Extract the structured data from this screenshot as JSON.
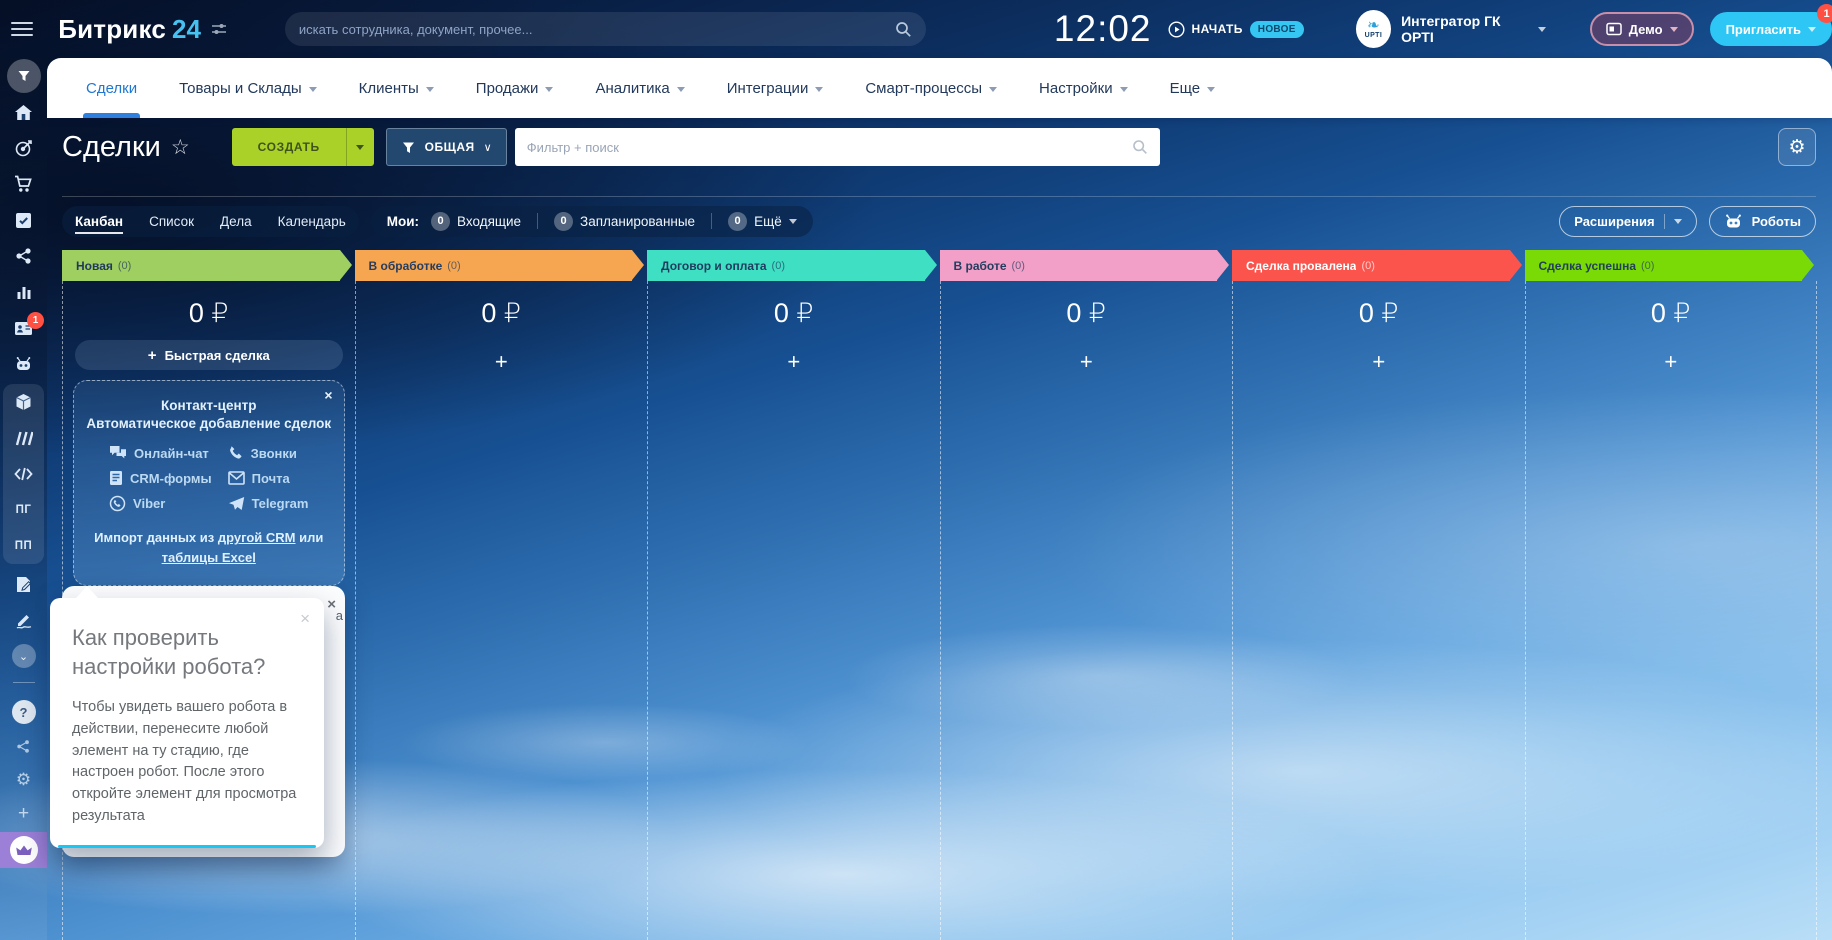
{
  "topbar": {
    "brand": "Битрикс",
    "brand_number": "24",
    "search_placeholder": "искать сотрудника, документ, прочее...",
    "time": "12:02",
    "start_label": "НАЧАТЬ",
    "start_badge": "НОВОЕ",
    "avatar_text": "UPTI",
    "account_name": "Интегратор ГК OPTI",
    "demo_label": "Демо",
    "invite_label": "Пригласить",
    "invite_badge": "1"
  },
  "nav": {
    "items": [
      {
        "label": "Сделки",
        "active": true
      },
      {
        "label": "Товары и Склады"
      },
      {
        "label": "Клиенты"
      },
      {
        "label": "Продажи"
      },
      {
        "label": "Аналитика"
      },
      {
        "label": "Интеграции"
      },
      {
        "label": "Смарт-процессы"
      },
      {
        "label": "Настройки"
      },
      {
        "label": "Еще"
      }
    ]
  },
  "toolbar": {
    "page_title": "Сделки",
    "star": "☆",
    "create_label": "СОЗДАТЬ",
    "preset_label": "ОБЩАЯ",
    "filter_placeholder": "Фильтр + поиск"
  },
  "views": {
    "tabs": [
      {
        "label": "Канбан",
        "active": true
      },
      {
        "label": "Список"
      },
      {
        "label": "Дела"
      },
      {
        "label": "Календарь"
      }
    ],
    "my_label": "Мои:",
    "counters": [
      {
        "count": "0",
        "label": "Входящие"
      },
      {
        "count": "0",
        "label": "Запланированные"
      },
      {
        "count": "0",
        "label": "Ещё",
        "has_chevron": true
      }
    ],
    "extensions_label": "Расширения",
    "robots_label": "Роботы"
  },
  "kanban": {
    "add_label": "+",
    "quick_deal_label": "Быстрая сделка",
    "columns": [
      {
        "title": "Новая",
        "count_label": "(0)",
        "sum": "0 ₽",
        "color": "#9fce61",
        "text_color": "#21395d"
      },
      {
        "title": "В обработке",
        "count_label": "(0)",
        "sum": "0 ₽",
        "color": "#f6a650",
        "text_color": "#273c5e"
      },
      {
        "title": "Договор и оплата",
        "count_label": "(0)",
        "sum": "0 ₽",
        "color": "#3fdfc3",
        "text_color": "#1f3b5e"
      },
      {
        "title": "В работе",
        "count_label": "(0)",
        "sum": "0 ₽",
        "color": "#f2a0c7",
        "text_color": "#253c5f"
      },
      {
        "title": "Сделка провалена",
        "count_label": "(0)",
        "sum": "0 ₽",
        "color": "#fb544d",
        "text_color": "#ffffff"
      },
      {
        "title": "Сделка успешна",
        "count_label": "(0)",
        "sum": "0 ₽",
        "color": "#79da05",
        "text_color": "#234059"
      }
    ]
  },
  "contact_center": {
    "close_label": "×",
    "title": "Контакт-центр",
    "subtitle": "Автоматическое добавление сделок",
    "channels": [
      {
        "icon": "chat-icon",
        "label": "Онлайн-чат"
      },
      {
        "icon": "phone-icon",
        "label": "Звонки"
      },
      {
        "icon": "form-icon",
        "label": "CRM-формы"
      },
      {
        "icon": "mail-icon",
        "label": "Почта"
      },
      {
        "icon": "viber-icon",
        "label": "Viber"
      },
      {
        "icon": "telegram-icon",
        "label": "Telegram"
      }
    ],
    "import_prefix": "Импорт данных из",
    "import_link_1": "другой CRM",
    "import_middle": "или",
    "import_link_2": "таблицы Excel"
  },
  "back_card": {
    "close_label": "×",
    "fragment": "а"
  },
  "tooltip": {
    "close_label": "×",
    "title": "Как проверить настройки робота?",
    "body": "Чтобы увидеть вашего робота в действии, перенесите любой элемент на ту стадию, где настроен робот. После этого откройте элемент для просмотра результата"
  },
  "sidebar": {
    "items": [
      {
        "icon": "crm-funnel-icon",
        "active": true
      },
      {
        "icon": "home-icon"
      },
      {
        "icon": "target-icon"
      },
      {
        "icon": "cart-icon"
      },
      {
        "icon": "tasks-icon"
      },
      {
        "icon": "network-icon"
      },
      {
        "icon": "chart-icon"
      },
      {
        "icon": "contacts-icon",
        "badge": "1"
      },
      {
        "icon": "robot-icon"
      },
      {
        "icon": "box-icon"
      },
      {
        "icon": "marketplace-icon"
      },
      {
        "icon": "code-icon"
      },
      {
        "icon": "pg-icon",
        "text": "ПГ"
      },
      {
        "icon": "pp-icon",
        "text": "ПП"
      },
      {
        "icon": "document-edit-icon"
      },
      {
        "icon": "signature-icon"
      },
      {
        "icon": "collapse-icon",
        "text": "⌄"
      },
      {
        "icon": "help-icon",
        "text": "?"
      },
      {
        "icon": "share-icon"
      },
      {
        "icon": "settings-icon",
        "text": "⚙"
      },
      {
        "icon": "add-icon",
        "text": "+"
      },
      {
        "icon": "crown-icon"
      }
    ]
  }
}
